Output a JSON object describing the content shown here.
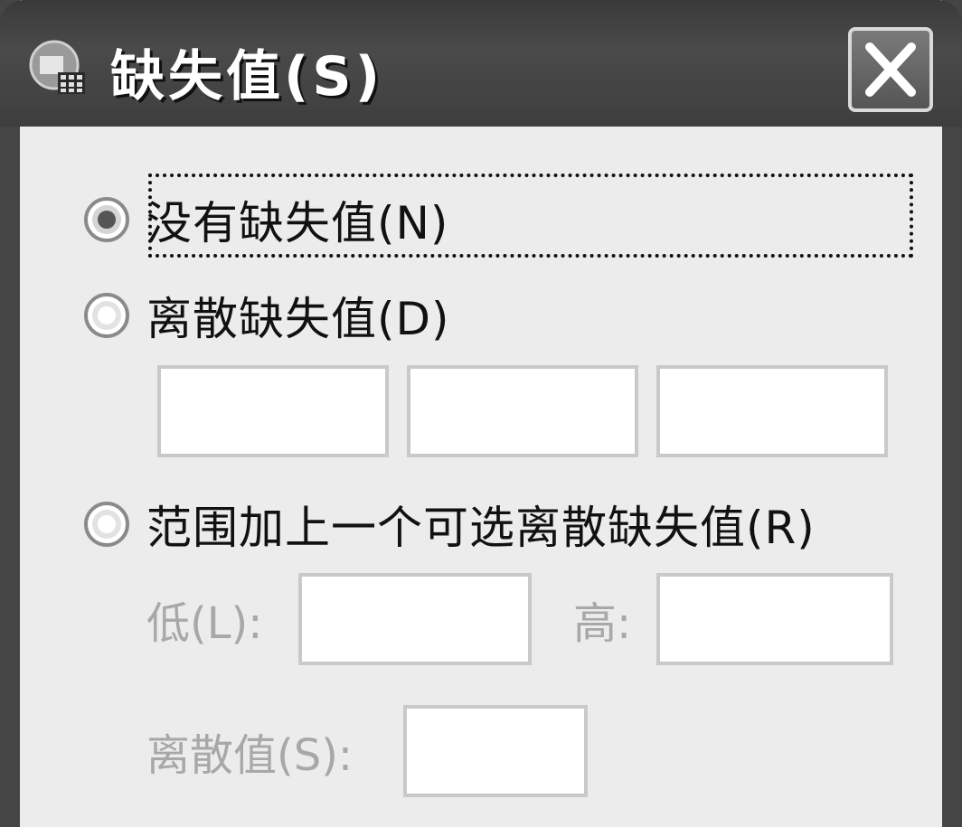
{
  "window": {
    "title": "缺失值(S)",
    "close_icon": "close-icon",
    "app_icon": "spss-app-icon"
  },
  "options": {
    "no_missing": {
      "label": "没有缺失值(N)",
      "selected": true
    },
    "discrete": {
      "label": "离散缺失值(D)",
      "selected": false,
      "values": [
        "",
        "",
        ""
      ]
    },
    "range": {
      "label": "范围加上一个可选离散缺失值(R)",
      "selected": false
    }
  },
  "range_fields": {
    "low_label": "低(L):",
    "low_value": "",
    "high_label": "高:",
    "high_value": "",
    "discrete_label": "离散值(S):",
    "discrete_value": ""
  },
  "colors": {
    "titlebar": "#3e3e3e",
    "dialog_bg": "#ececec",
    "disabled_text": "#a8a8a8"
  }
}
